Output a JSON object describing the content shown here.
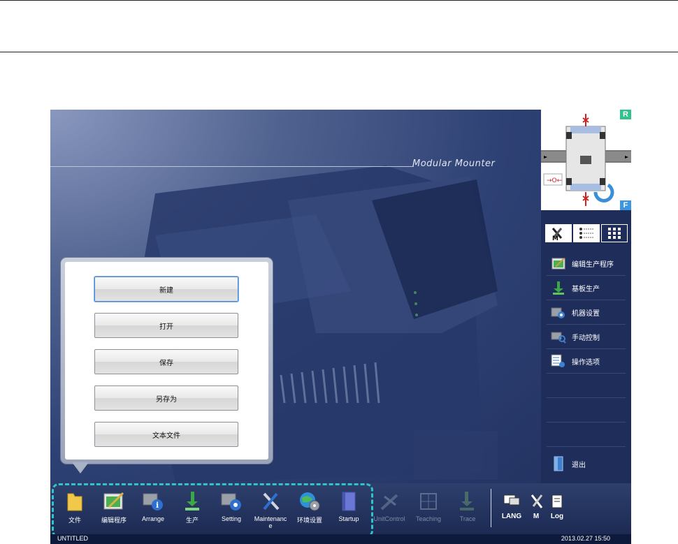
{
  "screen": {
    "watermark": "Modular Mounter"
  },
  "popup_menu": {
    "items": [
      {
        "label": "新建",
        "selected": true
      },
      {
        "label": "打开",
        "selected": false
      },
      {
        "label": "保存",
        "selected": false
      },
      {
        "label": "另存为",
        "selected": false
      },
      {
        "label": "文本文件",
        "selected": false
      }
    ]
  },
  "minimap": {
    "top_badge": "R",
    "bottom_badge": "F"
  },
  "right_panel": {
    "items": [
      {
        "label": "编辑生产程序",
        "icon": "edit-program-icon"
      },
      {
        "label": "基板生产",
        "icon": "production-icon"
      },
      {
        "label": "机器设置",
        "icon": "machine-setting-icon"
      },
      {
        "label": "手动控制",
        "icon": "manual-control-icon"
      },
      {
        "label": "操作选项",
        "icon": "operation-option-icon"
      }
    ],
    "exit_label": "退出"
  },
  "toolbar": {
    "tools": [
      {
        "label": "文件",
        "icon": "folder-icon",
        "enabled": true
      },
      {
        "label": "编辑程序",
        "icon": "edit-program-icon",
        "enabled": true
      },
      {
        "label": "Arrange",
        "icon": "arrange-icon",
        "enabled": true
      },
      {
        "label": "生产",
        "icon": "production-icon",
        "enabled": true
      },
      {
        "label": "Setting",
        "icon": "setting-icon",
        "enabled": true
      },
      {
        "label": "Maintenanc e",
        "icon": "wrench-icon",
        "enabled": true
      },
      {
        "label": "环境设置",
        "icon": "globe-gear-icon",
        "enabled": true
      },
      {
        "label": "Startup",
        "icon": "book-icon",
        "enabled": true
      },
      {
        "label": "UnitControl",
        "icon": "unit-control-icon",
        "enabled": false
      },
      {
        "label": "Teaching",
        "icon": "teaching-icon",
        "enabled": false
      },
      {
        "label": "Trace",
        "icon": "trace-icon",
        "enabled": false
      }
    ],
    "right_tools": [
      {
        "label": "LANG",
        "icon": "language-icon"
      },
      {
        "label": "M",
        "icon": "maintenance-mode-icon"
      },
      {
        "label": "Log",
        "icon": "log-icon"
      }
    ]
  },
  "status_bar": {
    "program_name": "UNTITLED",
    "datetime": "2013.02.27 15:50"
  },
  "colors": {
    "accent_dash": "#2ec4c8",
    "badge_green": "#2fc28a",
    "panel_bg": "#1f2d5a"
  }
}
